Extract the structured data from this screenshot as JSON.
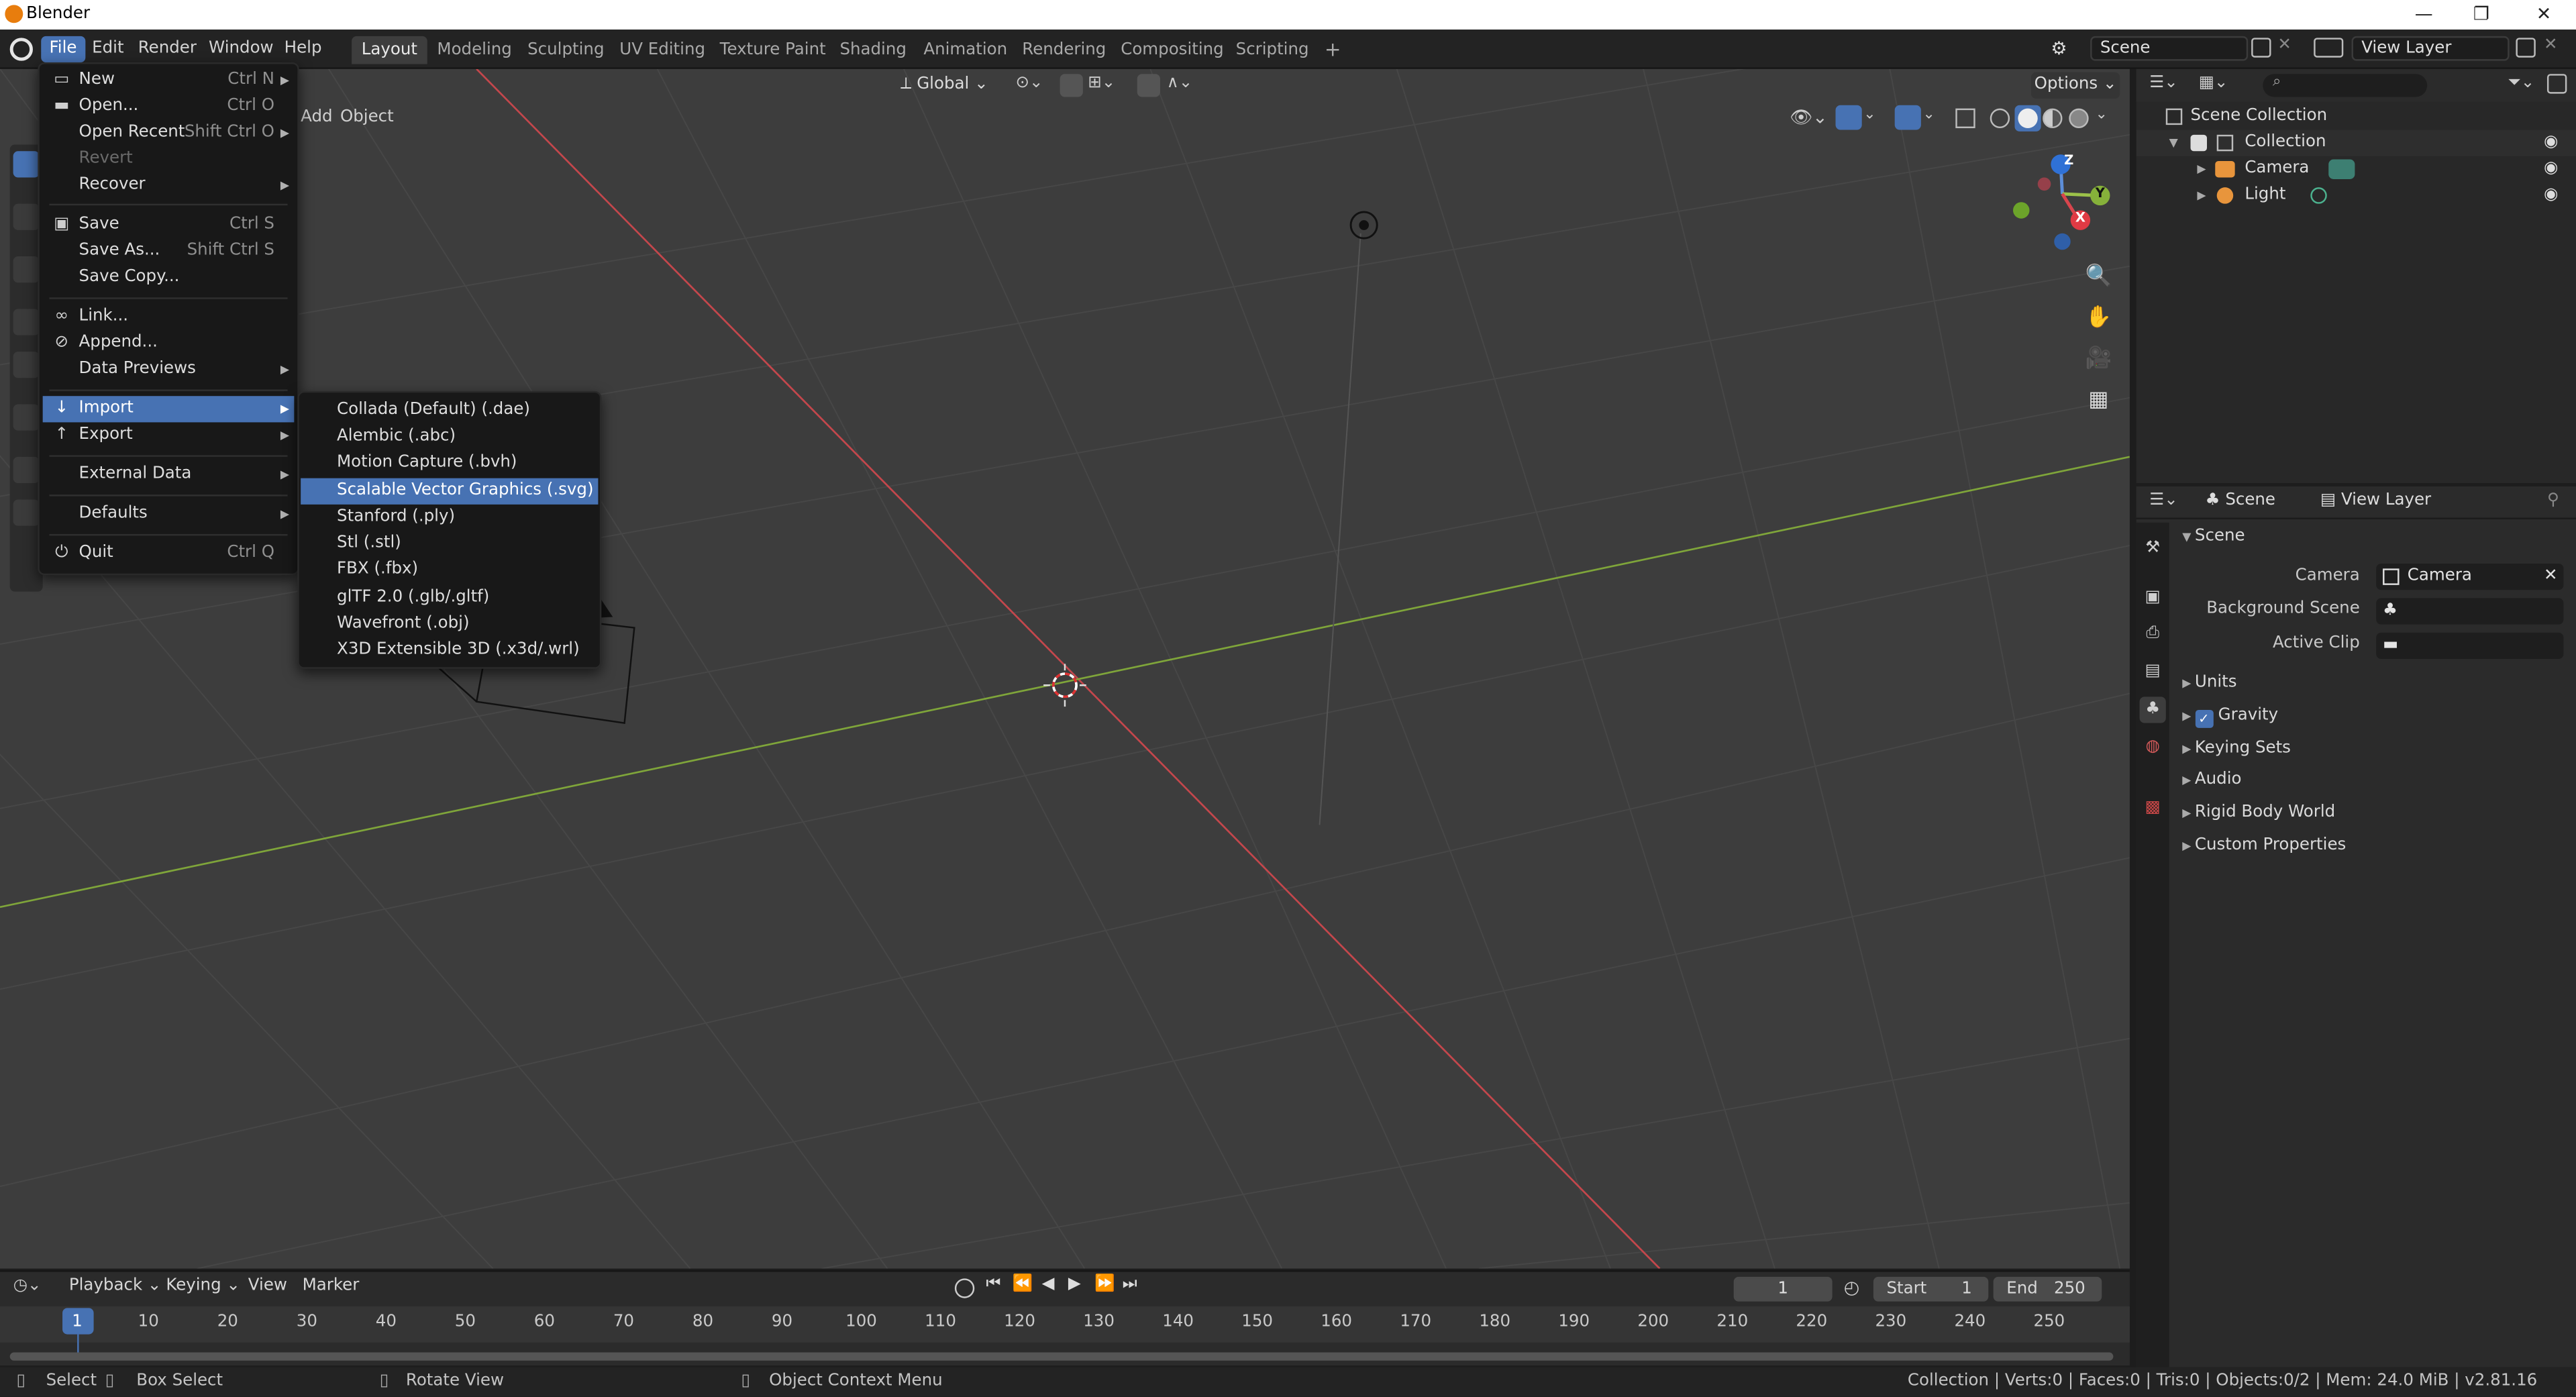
{
  "window": {
    "title": "Blender",
    "minimize": "—",
    "maximize": "❐",
    "close": "✕"
  },
  "topbar": {
    "menus": [
      "File",
      "Edit",
      "Render",
      "Window",
      "Help"
    ],
    "workspaces": [
      "Layout",
      "Modeling",
      "Sculpting",
      "UV Editing",
      "Texture Paint",
      "Shading",
      "Animation",
      "Rendering",
      "Compositing",
      "Scripting"
    ],
    "add_workspace": "+",
    "scene": "Scene",
    "view_layer": "View Layer"
  },
  "viewport": {
    "header": {
      "add": "Add",
      "object": "Object",
      "transform_orientation": "Global",
      "options": "Options"
    },
    "gizmo": {
      "x": "X",
      "y": "Y",
      "z": "Z"
    }
  },
  "file_menu": {
    "items": [
      {
        "label": "New",
        "shortcut": "Ctrl N",
        "icon": "new-file-icon",
        "arrow": true
      },
      {
        "label": "Open...",
        "shortcut": "Ctrl O",
        "icon": "folder-icon"
      },
      {
        "label": "Open Recent",
        "shortcut": "Shift Ctrl O",
        "arrow": true
      },
      {
        "label": "Revert",
        "shortcut": "",
        "disabled": true
      },
      {
        "label": "Recover",
        "shortcut": "",
        "arrow": true
      },
      {
        "label": "Save",
        "shortcut": "Ctrl S",
        "icon": "save-icon"
      },
      {
        "label": "Save As...",
        "shortcut": "Shift Ctrl S"
      },
      {
        "label": "Save Copy...",
        "shortcut": ""
      },
      {
        "label": "Link...",
        "shortcut": "",
        "icon": "link-icon"
      },
      {
        "label": "Append...",
        "shortcut": "",
        "icon": "append-icon"
      },
      {
        "label": "Data Previews",
        "shortcut": "",
        "arrow": true
      },
      {
        "label": "Import",
        "shortcut": "",
        "icon": "import-icon",
        "arrow": true,
        "highlighted": true
      },
      {
        "label": "Export",
        "shortcut": "",
        "icon": "export-icon",
        "arrow": true
      },
      {
        "label": "External Data",
        "shortcut": "",
        "arrow": true
      },
      {
        "label": "Defaults",
        "shortcut": "",
        "arrow": true
      },
      {
        "label": "Quit",
        "shortcut": "Ctrl Q",
        "icon": "power-icon"
      }
    ]
  },
  "import_menu": {
    "items": [
      "Collada (Default) (.dae)",
      "Alembic (.abc)",
      "Motion Capture (.bvh)",
      "Scalable Vector Graphics (.svg)",
      "Stanford (.ply)",
      "Stl (.stl)",
      "FBX (.fbx)",
      "glTF 2.0 (.glb/.gltf)",
      "Wavefront (.obj)",
      "X3D Extensible 3D (.x3d/.wrl)"
    ],
    "highlighted": "Scalable Vector Graphics (.svg)"
  },
  "outliner": {
    "root": "Scene Collection",
    "collection": "Collection",
    "objects": [
      "Camera",
      "Light"
    ]
  },
  "properties": {
    "header_scene": "Scene",
    "header_view_layer": "View Layer",
    "panel": "Scene",
    "camera_label": "Camera",
    "camera_value": "Camera",
    "background_scene_label": "Background Scene",
    "active_clip_label": "Active Clip",
    "sections": [
      "Units",
      "Gravity",
      "Keying Sets",
      "Audio",
      "Rigid Body World",
      "Custom Properties"
    ]
  },
  "timeline": {
    "menus": [
      "Playback",
      "Keying",
      "View",
      "Marker"
    ],
    "current_frame": "1",
    "start_label": "Start",
    "start_value": "1",
    "end_label": "End",
    "end_value": "250",
    "ticks": [
      "1",
      "10",
      "20",
      "30",
      "40",
      "50",
      "60",
      "70",
      "80",
      "90",
      "100",
      "110",
      "120",
      "130",
      "140",
      "150",
      "160",
      "170",
      "180",
      "190",
      "200",
      "210",
      "220",
      "230",
      "240",
      "250"
    ]
  },
  "statusbar": {
    "select": "Select",
    "box_select": "Box Select",
    "rotate_view": "Rotate View",
    "context_menu": "Object Context Menu",
    "stats": "Collection | Verts:0 | Faces:0 | Tris:0 | Objects:0/2 | Mem: 24.0 MiB | v2.81.16"
  },
  "colors": {
    "accent": "#4772b3",
    "x_axis": "#c4474c",
    "y_axis": "#7fa53a",
    "viewport_bg": "#3d3d3d"
  }
}
